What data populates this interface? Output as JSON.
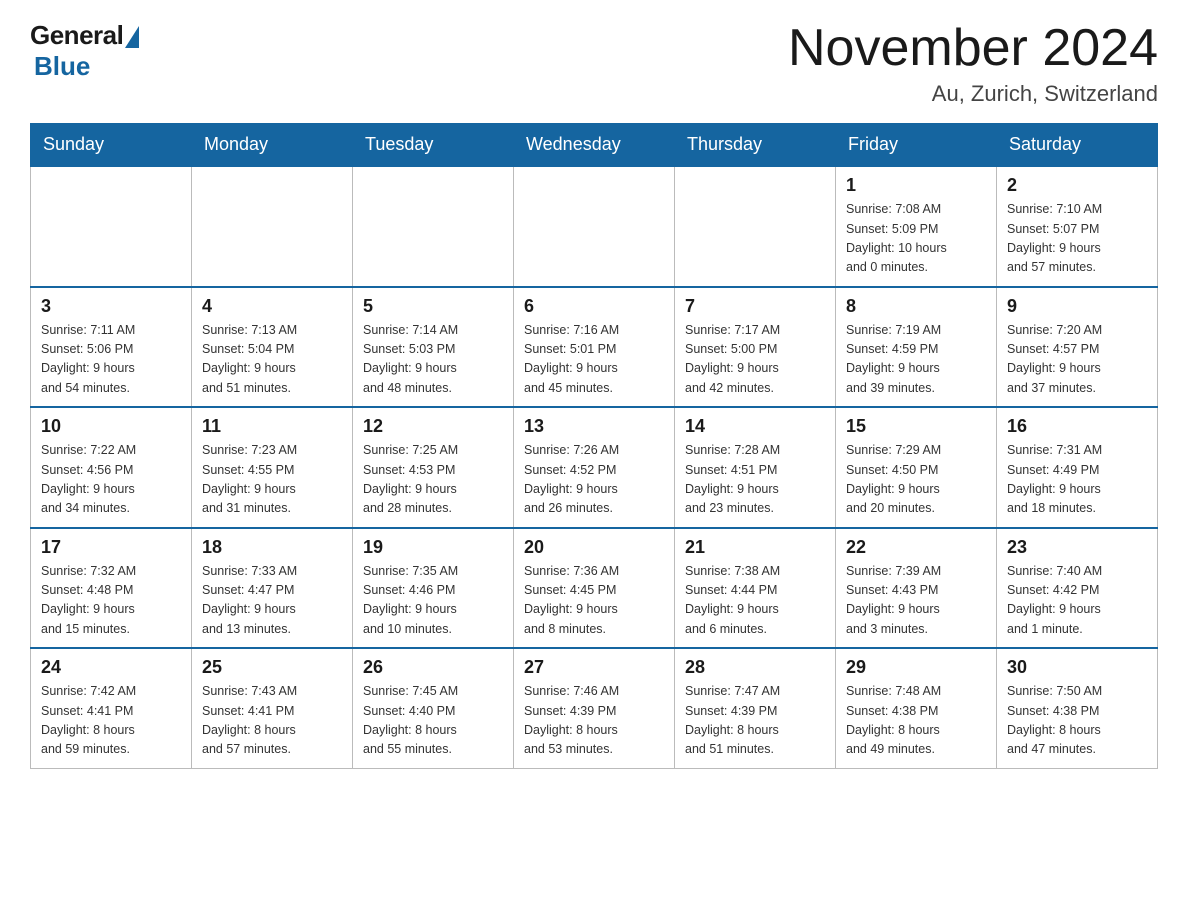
{
  "logo": {
    "general": "General",
    "blue": "Blue"
  },
  "header": {
    "month_year": "November 2024",
    "location": "Au, Zurich, Switzerland"
  },
  "days_of_week": [
    "Sunday",
    "Monday",
    "Tuesday",
    "Wednesday",
    "Thursday",
    "Friday",
    "Saturday"
  ],
  "weeks": [
    [
      {
        "day": "",
        "info": ""
      },
      {
        "day": "",
        "info": ""
      },
      {
        "day": "",
        "info": ""
      },
      {
        "day": "",
        "info": ""
      },
      {
        "day": "",
        "info": ""
      },
      {
        "day": "1",
        "info": "Sunrise: 7:08 AM\nSunset: 5:09 PM\nDaylight: 10 hours\nand 0 minutes."
      },
      {
        "day": "2",
        "info": "Sunrise: 7:10 AM\nSunset: 5:07 PM\nDaylight: 9 hours\nand 57 minutes."
      }
    ],
    [
      {
        "day": "3",
        "info": "Sunrise: 7:11 AM\nSunset: 5:06 PM\nDaylight: 9 hours\nand 54 minutes."
      },
      {
        "day": "4",
        "info": "Sunrise: 7:13 AM\nSunset: 5:04 PM\nDaylight: 9 hours\nand 51 minutes."
      },
      {
        "day": "5",
        "info": "Sunrise: 7:14 AM\nSunset: 5:03 PM\nDaylight: 9 hours\nand 48 minutes."
      },
      {
        "day": "6",
        "info": "Sunrise: 7:16 AM\nSunset: 5:01 PM\nDaylight: 9 hours\nand 45 minutes."
      },
      {
        "day": "7",
        "info": "Sunrise: 7:17 AM\nSunset: 5:00 PM\nDaylight: 9 hours\nand 42 minutes."
      },
      {
        "day": "8",
        "info": "Sunrise: 7:19 AM\nSunset: 4:59 PM\nDaylight: 9 hours\nand 39 minutes."
      },
      {
        "day": "9",
        "info": "Sunrise: 7:20 AM\nSunset: 4:57 PM\nDaylight: 9 hours\nand 37 minutes."
      }
    ],
    [
      {
        "day": "10",
        "info": "Sunrise: 7:22 AM\nSunset: 4:56 PM\nDaylight: 9 hours\nand 34 minutes."
      },
      {
        "day": "11",
        "info": "Sunrise: 7:23 AM\nSunset: 4:55 PM\nDaylight: 9 hours\nand 31 minutes."
      },
      {
        "day": "12",
        "info": "Sunrise: 7:25 AM\nSunset: 4:53 PM\nDaylight: 9 hours\nand 28 minutes."
      },
      {
        "day": "13",
        "info": "Sunrise: 7:26 AM\nSunset: 4:52 PM\nDaylight: 9 hours\nand 26 minutes."
      },
      {
        "day": "14",
        "info": "Sunrise: 7:28 AM\nSunset: 4:51 PM\nDaylight: 9 hours\nand 23 minutes."
      },
      {
        "day": "15",
        "info": "Sunrise: 7:29 AM\nSunset: 4:50 PM\nDaylight: 9 hours\nand 20 minutes."
      },
      {
        "day": "16",
        "info": "Sunrise: 7:31 AM\nSunset: 4:49 PM\nDaylight: 9 hours\nand 18 minutes."
      }
    ],
    [
      {
        "day": "17",
        "info": "Sunrise: 7:32 AM\nSunset: 4:48 PM\nDaylight: 9 hours\nand 15 minutes."
      },
      {
        "day": "18",
        "info": "Sunrise: 7:33 AM\nSunset: 4:47 PM\nDaylight: 9 hours\nand 13 minutes."
      },
      {
        "day": "19",
        "info": "Sunrise: 7:35 AM\nSunset: 4:46 PM\nDaylight: 9 hours\nand 10 minutes."
      },
      {
        "day": "20",
        "info": "Sunrise: 7:36 AM\nSunset: 4:45 PM\nDaylight: 9 hours\nand 8 minutes."
      },
      {
        "day": "21",
        "info": "Sunrise: 7:38 AM\nSunset: 4:44 PM\nDaylight: 9 hours\nand 6 minutes."
      },
      {
        "day": "22",
        "info": "Sunrise: 7:39 AM\nSunset: 4:43 PM\nDaylight: 9 hours\nand 3 minutes."
      },
      {
        "day": "23",
        "info": "Sunrise: 7:40 AM\nSunset: 4:42 PM\nDaylight: 9 hours\nand 1 minute."
      }
    ],
    [
      {
        "day": "24",
        "info": "Sunrise: 7:42 AM\nSunset: 4:41 PM\nDaylight: 8 hours\nand 59 minutes."
      },
      {
        "day": "25",
        "info": "Sunrise: 7:43 AM\nSunset: 4:41 PM\nDaylight: 8 hours\nand 57 minutes."
      },
      {
        "day": "26",
        "info": "Sunrise: 7:45 AM\nSunset: 4:40 PM\nDaylight: 8 hours\nand 55 minutes."
      },
      {
        "day": "27",
        "info": "Sunrise: 7:46 AM\nSunset: 4:39 PM\nDaylight: 8 hours\nand 53 minutes."
      },
      {
        "day": "28",
        "info": "Sunrise: 7:47 AM\nSunset: 4:39 PM\nDaylight: 8 hours\nand 51 minutes."
      },
      {
        "day": "29",
        "info": "Sunrise: 7:48 AM\nSunset: 4:38 PM\nDaylight: 8 hours\nand 49 minutes."
      },
      {
        "day": "30",
        "info": "Sunrise: 7:50 AM\nSunset: 4:38 PM\nDaylight: 8 hours\nand 47 minutes."
      }
    ]
  ]
}
